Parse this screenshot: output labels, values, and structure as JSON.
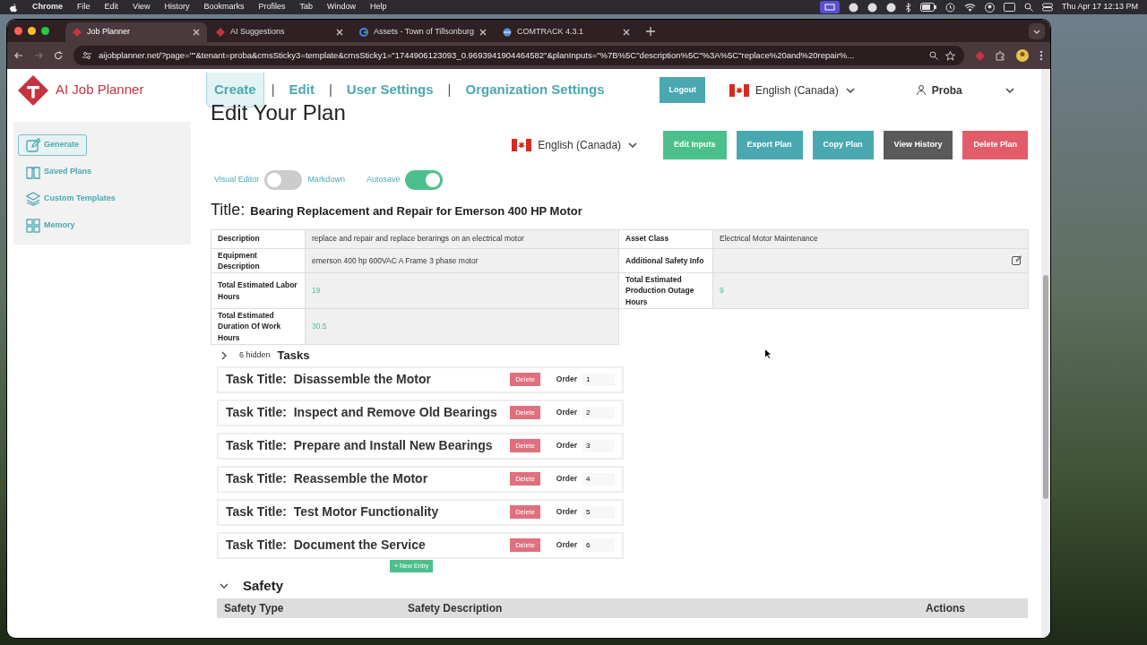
{
  "menubar": {
    "app": "Chrome",
    "menus": [
      "File",
      "Edit",
      "View",
      "History",
      "Bookmarks",
      "Profiles",
      "Tab",
      "Window",
      "Help"
    ],
    "clock": "Thu Apr 17  12:13 PM"
  },
  "browser": {
    "tabs": [
      {
        "title": "Job Planner",
        "selected": true
      },
      {
        "title": "AI Suggestions",
        "selected": false
      },
      {
        "title": "Assets - Town of Tillsonburg",
        "selected": false
      },
      {
        "title": "COMTRACK 4.3.1",
        "selected": false
      }
    ],
    "url": "aijobplanner.net/?page=\"\"&tenant=proba&cmsSticky3=template&cmsSticky1=\"1744906123093_0.9693941904464582\"&planInputs=\"%7B%5C\"description%5C\"%3A%5C\"replace%20and%20repair%..."
  },
  "header": {
    "brand": "AI Job Planner",
    "nav": [
      {
        "label": "Create",
        "selected": true
      },
      {
        "label": "Edit",
        "selected": false
      },
      {
        "label": "User Settings",
        "selected": false
      },
      {
        "label": "Organization Settings",
        "selected": false
      }
    ],
    "separator": "|",
    "logout": "Logout",
    "language": "English (Canada)",
    "user": "Proba"
  },
  "sidebar": {
    "items": [
      {
        "label": "Generate",
        "selected": true
      },
      {
        "label": "Saved Plans",
        "selected": false
      },
      {
        "label": "Custom Templates",
        "selected": false
      },
      {
        "label": "Memory",
        "selected": false
      }
    ]
  },
  "page": {
    "heading": "Edit Your Plan",
    "language": "English (Canada)",
    "actions": [
      {
        "label": "Edit Inputs",
        "kind": "success"
      },
      {
        "label": "Export Plan",
        "kind": "info"
      },
      {
        "label": "Copy Plan",
        "kind": "info"
      },
      {
        "label": "View History",
        "kind": "dark"
      },
      {
        "label": "Delete Plan",
        "kind": "danger"
      }
    ],
    "editor_toggle": {
      "left": "Visual Editor",
      "right": "Markdown",
      "on": false
    },
    "autosave_toggle": {
      "label": "Autosave",
      "on": true
    },
    "title_label": "Title:",
    "title": "Bearing Replacement and Repair for Emerson 400 HP Motor",
    "details": [
      [
        {
          "label": "Description",
          "value": "replace and repair and replace berarings on an electrical motor",
          "kind": "text"
        },
        {
          "label": "Asset Class",
          "value": "Electrical Motor Maintenance",
          "kind": "text"
        }
      ],
      [
        {
          "label": "Equipment Description",
          "value": "emerson 400 hp 600VAC A Frame 3 phase motor",
          "kind": "text"
        },
        {
          "label": "Additional Safety Info",
          "kind": "editable"
        }
      ],
      [
        {
          "label": "Total Estimated Labor Hours",
          "value": "19",
          "kind": "number"
        },
        {
          "label": "Total Estimated Production Outage Hours",
          "value": "9",
          "kind": "number"
        }
      ],
      [
        {
          "label": "Total Estimated Duration Of Work Hours",
          "value": "30.5",
          "kind": "number"
        }
      ]
    ],
    "tasks": {
      "expanded": false,
      "hidden": "6 hidden",
      "label": "Tasks",
      "new_entry": "+ New Entry",
      "items": [
        {
          "prefix": "Task Title:",
          "title": "Disassemble the Motor",
          "delete": "Delete",
          "order_label": "Order",
          "order": "1"
        },
        {
          "prefix": "Task Title:",
          "title": "Inspect and Remove Old Bearings",
          "delete": "Delete",
          "order_label": "Order",
          "order": "2"
        },
        {
          "prefix": "Task Title:",
          "title": "Prepare and Install New Bearings",
          "delete": "Delete",
          "order_label": "Order",
          "order": "3"
        },
        {
          "prefix": "Task Title:",
          "title": "Reassemble the Motor",
          "delete": "Delete",
          "order_label": "Order",
          "order": "4"
        },
        {
          "prefix": "Task Title:",
          "title": "Test Motor Functionality",
          "delete": "Delete",
          "order_label": "Order",
          "order": "5"
        },
        {
          "prefix": "Task Title:",
          "title": "Document the Service",
          "delete": "Delete",
          "order_label": "Order",
          "order": "6"
        }
      ]
    },
    "safety": {
      "expanded": true,
      "label": "Safety",
      "columns": [
        "Safety Type",
        "Safety Description",
        "Actions"
      ]
    }
  }
}
